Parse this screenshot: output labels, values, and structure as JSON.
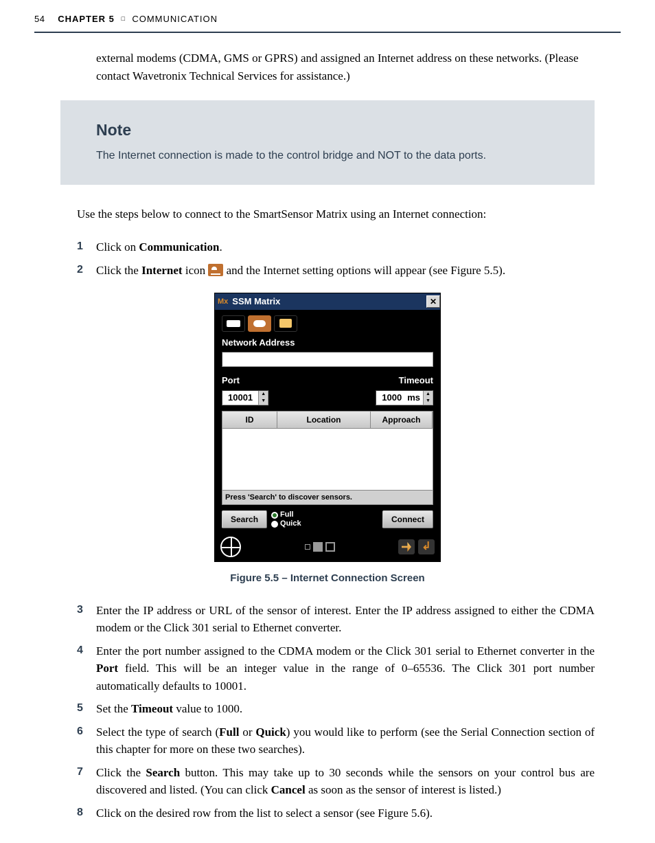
{
  "header": {
    "page_number": "54",
    "chapter_label": "CHAPTER 5",
    "chapter_name": "COMMUNICATION"
  },
  "intro_paragraph": "external modems (CDMA, GMS or GPRS) and assigned an Internet address on these networks. (Please contact Wavetronix Technical Services for assistance.)",
  "note": {
    "heading": "Note",
    "text": "The Internet connection is made to the control bridge and NOT to the data ports."
  },
  "lead_sentence": "Use the steps below to connect to the SmartSensor Matrix using an Internet connection:",
  "steps_part1": [
    {
      "n": "1",
      "pre": "Click on ",
      "bold": "Communication",
      "post": "."
    },
    {
      "n": "2",
      "pre": "Click the ",
      "bold": "Internet",
      "post1": " icon ",
      "post2": " and the Internet setting options will appear (see Figure 5.5)."
    }
  ],
  "figure": {
    "caption": "Figure 5.5 – Internet Connection Screen",
    "window": {
      "mx": "Mx",
      "title": "SSM Matrix",
      "section_label": "Network Address",
      "port_label": "Port",
      "port_value": "10001",
      "timeout_label": "Timeout",
      "timeout_value": "1000",
      "timeout_unit": "ms",
      "col_id": "ID",
      "col_location": "Location",
      "col_approach": "Approach",
      "hint": "Press 'Search' to discover sensors.",
      "search_btn": "Search",
      "radio_full": "Full",
      "radio_quick": "Quick",
      "connect_btn": "Connect"
    }
  },
  "steps_part2": [
    {
      "n": "3",
      "html": "Enter the IP address or URL of the sensor of interest. Enter the IP address assigned to either the CDMA modem or the Click 301 serial to Ethernet converter."
    },
    {
      "n": "4",
      "html": "Enter the port number assigned to the CDMA modem or the Click 301 serial to Ethernet converter in the <b>Port</b> field. This will be an integer value in the range of 0–65536. The Click 301 port number automatically defaults to 10001."
    },
    {
      "n": "5",
      "html": "Set the <b>Timeout</b> value to 1000."
    },
    {
      "n": "6",
      "html": "Select the type of search (<b>Full</b> or <b>Quick</b>) you would like to perform (see the Serial Connection section of this chapter for more on these two searches)."
    },
    {
      "n": "7",
      "html": "Click the <b>Search</b> button. This may take up to 30 seconds while the sensors on your control bus are discovered and listed. (You can click <b>Cancel</b> as soon as the sensor of interest is listed.)"
    },
    {
      "n": "8",
      "html": "Click on the desired row from the list to select a sensor (see Figure 5.6)."
    }
  ]
}
